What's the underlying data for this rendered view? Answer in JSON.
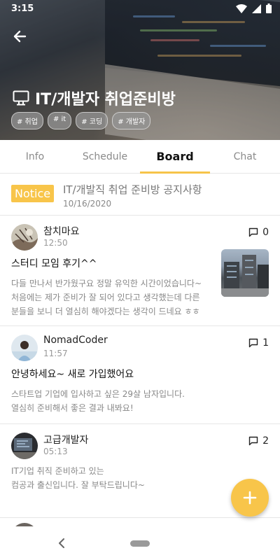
{
  "status_bar": {
    "time": "3:15"
  },
  "room": {
    "icon": "monitor-icon",
    "title": "IT/개발자 취업준비방",
    "tags": [
      "# 취업",
      "# it",
      "# 코딩",
      "# 개발자"
    ]
  },
  "tabs": [
    {
      "label": "Info",
      "active": false
    },
    {
      "label": "Schedule",
      "active": false
    },
    {
      "label": "Board",
      "active": true
    },
    {
      "label": "Chat",
      "active": false
    }
  ],
  "notice": {
    "badge": "Notice",
    "title": "IT/개발직 취업 준비방 공지사항",
    "date": "10/16/2020"
  },
  "posts": [
    {
      "author": "참치마요",
      "time": "12:50",
      "comments": "0",
      "title": "스터디 모임 후기^^",
      "body": [
        "다들 만나서 반가웠구요 정말 유익한 시간이었습니다~",
        "처음에는 제가 준비가 잘 되어 있다고 생각했는데 다른",
        "분들을 보니 더 열심히 해야겠다는 생각이 드네요 ㅎㅎ"
      ],
      "has_image": true
    },
    {
      "author": "NomadCoder",
      "time": "11:57",
      "comments": "1",
      "title": "안녕하세요~ 새로 가입했어요",
      "body": [
        "스타트업 기업에 입사하고 싶은 29살 남자입니다.",
        "열심히 준비해서 좋은 결과 내봐요!"
      ],
      "has_image": false
    },
    {
      "author": "고급개발자",
      "time": "05:13",
      "comments": "2",
      "title": "",
      "body": [
        "IT기업 취직 준비하고 있는",
        "컴공과 출신입니다. 잘 부탁드립니다~"
      ],
      "has_image": false
    }
  ],
  "colors": {
    "accent": "#f8c54a",
    "tab_active": "#111111",
    "tab_inactive": "#8a8a8a"
  }
}
